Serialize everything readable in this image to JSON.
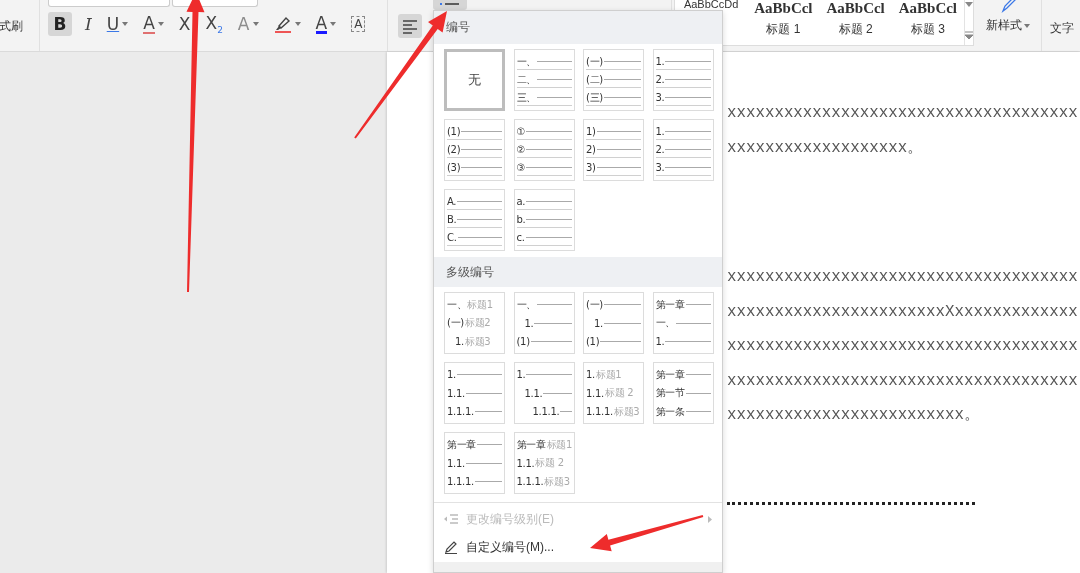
{
  "ribbon": {
    "format_painter": {
      "label": "式刷"
    },
    "format_buttons": [
      {
        "kind": "bold",
        "label": "B",
        "selected": true,
        "menu": false
      },
      {
        "kind": "italic",
        "label": "I",
        "selected": false,
        "menu": false
      },
      {
        "kind": "underline",
        "label": "U",
        "selected": false,
        "menu": true
      },
      {
        "kind": "strike",
        "label": "A",
        "selected": false,
        "menu": true
      },
      {
        "kind": "plain",
        "label": "X",
        "selected": false,
        "menu": false
      },
      {
        "kind": "subscript",
        "label": "X$_{2}$",
        "selected": false,
        "menu": false
      },
      {
        "kind": "outline",
        "label": "A",
        "selected": false,
        "menu": true
      },
      {
        "kind": "highlighter",
        "selected": false,
        "menu": true
      },
      {
        "kind": "font_color",
        "label": "A",
        "selected": false,
        "menu": true
      },
      {
        "kind": "char_border",
        "label": "A",
        "selected": false,
        "menu": false
      }
    ],
    "paragraph_buttons": [
      {
        "kind": "numbering",
        "selected": true
      },
      {
        "kind": "align_left",
        "selected": true
      }
    ],
    "styles": [
      {
        "preview": "AaBbCcDd",
        "kind": "body"
      },
      {
        "preview": "AaBbCcl",
        "name": "标题 1",
        "kind": "heading"
      },
      {
        "preview": "AaBbCcl",
        "name": "标题 2",
        "kind": "heading"
      },
      {
        "preview": "AaBbCcl",
        "name": "标题 3",
        "kind": "heading"
      }
    ],
    "new_style": {
      "label": "新样式"
    },
    "text_tools": {
      "label": "文字"
    }
  },
  "document": {
    "paragraphs": [
      [
        "xxxxxxxxxxxxxxxxxxxxxxxxxxxxxxxxxxxxx",
        "xxxxxxxxxxxxxxxxxxx。"
      ],
      [
        "xxxxxxxxxxxxxxxxxxxxxxxxxxxxxxxxxxxxx",
        "xxxxxxxxxxxxxxxxxxxxxxxXxxxxxxxxxxxxx",
        "xxxxxxxxxxxxxxxxxxxxxxxxxxxxxxxxxxxxx",
        "xxxxxxxxxxxxxxxxxxxxxxxxxxxxxxxxxxxxx",
        "xxxxxxxxxxxxxxxxxxxxxxxxx。"
      ]
    ]
  },
  "numbering_menu": {
    "sections": [
      {
        "title": "编号",
        "tiles": [
          {
            "kind": "none",
            "label": "无",
            "selected": true
          },
          {
            "kind": "list",
            "selected": false,
            "lines": [
              {
                "label": "一、"
              },
              {
                "label": "二、"
              },
              {
                "label": "三、"
              }
            ]
          },
          {
            "kind": "list",
            "selected": false,
            "lines": [
              {
                "label": "(一)"
              },
              {
                "label": "(二)"
              },
              {
                "label": "(三)"
              }
            ]
          },
          {
            "kind": "list",
            "selected": false,
            "lines": [
              {
                "label": "1."
              },
              {
                "label": "2."
              },
              {
                "label": "3."
              }
            ]
          },
          {
            "kind": "list",
            "selected": false,
            "lines": [
              {
                "label": "(1)"
              },
              {
                "label": "(2)"
              },
              {
                "label": "(3)"
              }
            ]
          },
          {
            "kind": "list",
            "selected": false,
            "lines": [
              {
                "label": "①"
              },
              {
                "label": "②"
              },
              {
                "label": "③"
              }
            ]
          },
          {
            "kind": "list",
            "selected": false,
            "lines": [
              {
                "label": "1)"
              },
              {
                "label": "2)"
              },
              {
                "label": "3)"
              }
            ]
          },
          {
            "kind": "list",
            "selected": false,
            "lines": [
              {
                "label": "1."
              },
              {
                "label": "2."
              },
              {
                "label": "3."
              }
            ]
          },
          {
            "kind": "list",
            "selected": false,
            "lines": [
              {
                "label": "A."
              },
              {
                "label": "B."
              },
              {
                "label": "C."
              }
            ]
          },
          {
            "kind": "list",
            "selected": false,
            "lines": [
              {
                "label": "a."
              },
              {
                "label": "b."
              },
              {
                "label": "c."
              }
            ]
          }
        ]
      },
      {
        "title": "多级编号",
        "tiles": [
          {
            "kind": "outline",
            "selected": false,
            "lines": [
              {
                "label": "一、",
                "caption": "标题1"
              },
              {
                "label": "(一)",
                "caption": "标题2",
                "children": [
                  {
                    "label": "1.",
                    "caption": "标题3"
                  }
                ]
              }
            ]
          },
          {
            "kind": "outline",
            "selected": false,
            "lines": [
              {
                "label": "一、",
                "children": [
                  {
                    "label": "1."
                  }
                ]
              },
              {
                "label": "(1)"
              }
            ]
          },
          {
            "kind": "outline",
            "selected": false,
            "lines": [
              {
                "label": "(一)",
                "children": [
                  {
                    "label": "1."
                  }
                ]
              },
              {
                "label": "(1)"
              }
            ]
          },
          {
            "kind": "outline",
            "selected": false,
            "lines": [
              {
                "label": "第一章"
              },
              {
                "label": "一、"
              },
              {
                "label": "1."
              }
            ]
          },
          {
            "kind": "outline",
            "selected": false,
            "lines": [
              {
                "label": "1."
              },
              {
                "label": "1.1."
              },
              {
                "label": "1.1.1."
              }
            ]
          },
          {
            "kind": "outline",
            "selected": false,
            "lines": [
              {
                "label": "1.",
                "children": [
                  {
                    "label": "1.1.",
                    "children": [
                      {
                        "label": "1.1.1."
                      }
                    ]
                  }
                ]
              }
            ]
          },
          {
            "kind": "outline",
            "selected": false,
            "lines": [
              {
                "label": "1.",
                "caption": "标题1"
              },
              {
                "label": "1.1.",
                "caption": "标题 2"
              },
              {
                "label": "1.1.1.",
                "caption": "标题3"
              }
            ]
          },
          {
            "kind": "outline",
            "selected": false,
            "lines": [
              {
                "label": "第一章"
              },
              {
                "label": "第一节"
              },
              {
                "label": "第一条"
              }
            ]
          },
          {
            "kind": "outline",
            "selected": false,
            "lines": [
              {
                "label": "第一章"
              },
              {
                "label": "1.1."
              },
              {
                "label": "1.1.1."
              }
            ]
          },
          {
            "kind": "outline",
            "selected": false,
            "lines": [
              {
                "label": "第一章",
                "caption": "标题1"
              },
              {
                "label": "1.1.",
                "caption": "标题 2"
              },
              {
                "label": "1.1.1.",
                "caption": "标题3"
              }
            ]
          }
        ]
      }
    ],
    "items": [
      {
        "kind": "level",
        "label": "更改编号级别(E)",
        "disabled": true,
        "submenu": true
      },
      {
        "kind": "pencil",
        "label": "自定义编号(M)...",
        "disabled": false,
        "submenu": false
      }
    ]
  },
  "annotations": [
    {
      "kind": "arrow"
    },
    {
      "kind": "arrow"
    },
    {
      "kind": "arrow"
    }
  ]
}
